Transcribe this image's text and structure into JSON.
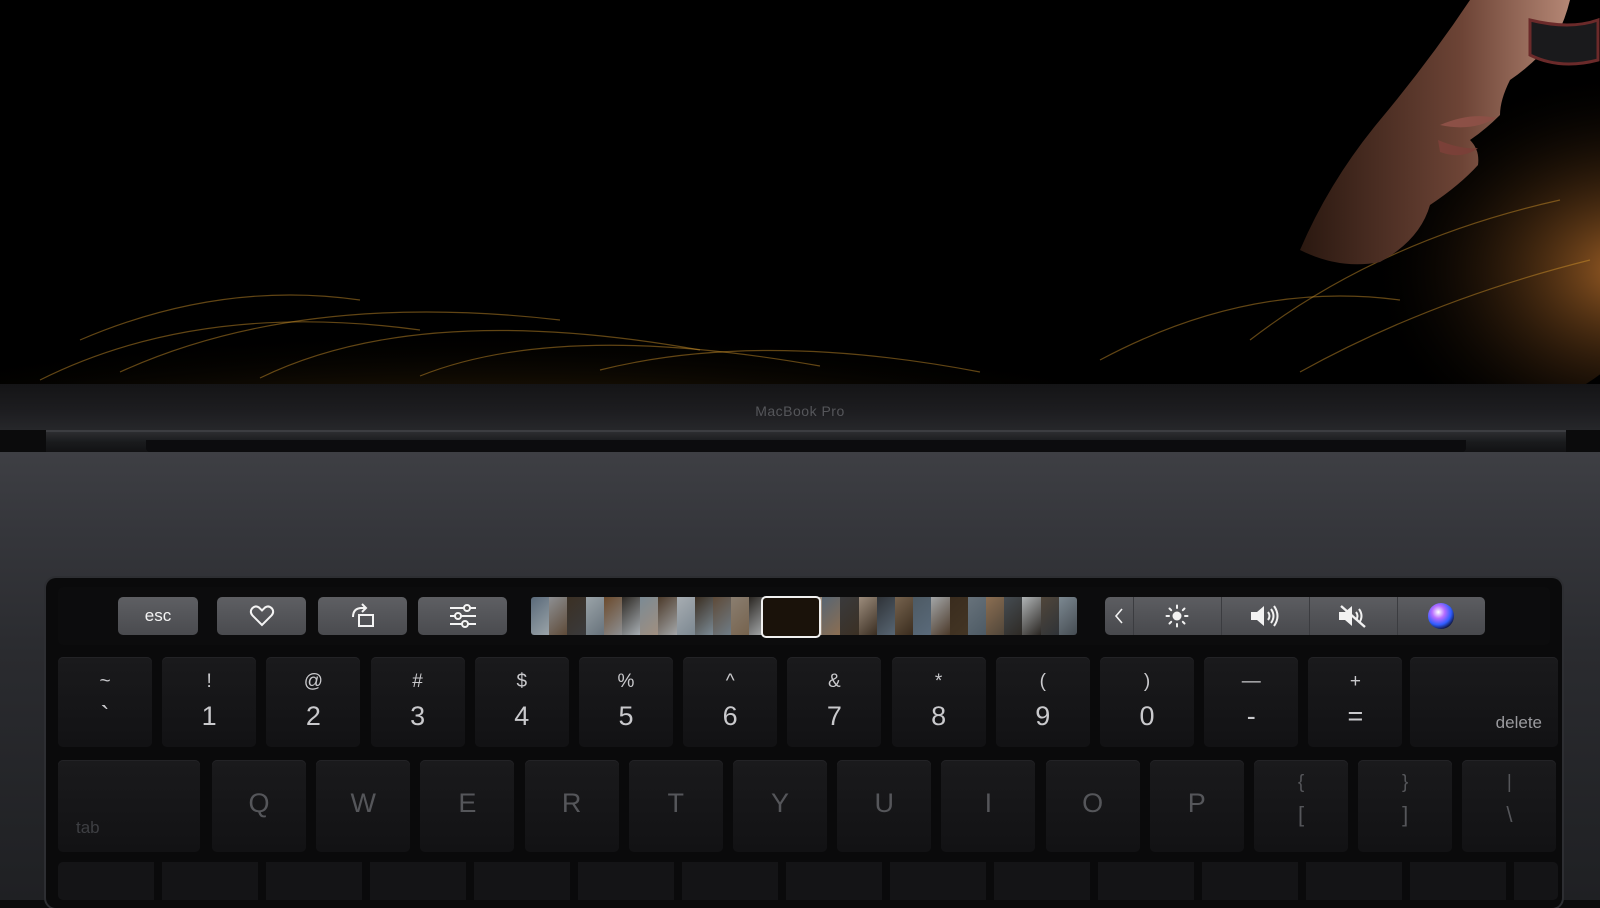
{
  "screen": {
    "brand_label": "MacBook Pro"
  },
  "touch_bar": {
    "esc_label": "esc",
    "buttons": [
      {
        "name": "favorite",
        "icon": "heart-icon"
      },
      {
        "name": "rotate",
        "icon": "rotate-icon"
      },
      {
        "name": "adjust",
        "icon": "sliders-icon"
      }
    ],
    "filmstrip": {
      "thumbnail_count": 30,
      "selected_index": 12
    },
    "control_strip": {
      "collapse_icon": "chevron-left-icon",
      "items": [
        {
          "name": "brightness",
          "icon": "brightness-icon"
        },
        {
          "name": "volume",
          "icon": "volume-icon"
        },
        {
          "name": "mute",
          "icon": "mute-icon"
        },
        {
          "name": "siri",
          "icon": "siri-icon"
        }
      ]
    },
    "colors": {
      "button_bg": "#55565a",
      "glyph": "#f4f4f4",
      "selection_border": "#f0f0f0"
    }
  },
  "keyboard": {
    "number_row": [
      {
        "top": "~",
        "bottom": "`"
      },
      {
        "top": "!",
        "bottom": "1"
      },
      {
        "top": "@",
        "bottom": "2"
      },
      {
        "top": "#",
        "bottom": "3"
      },
      {
        "top": "$",
        "bottom": "4"
      },
      {
        "top": "%",
        "bottom": "5"
      },
      {
        "top": "^",
        "bottom": "6"
      },
      {
        "top": "&",
        "bottom": "7"
      },
      {
        "top": "*",
        "bottom": "8"
      },
      {
        "top": "(",
        "bottom": "9"
      },
      {
        "top": ")",
        "bottom": "0"
      },
      {
        "top": "—",
        "bottom": "-"
      },
      {
        "top": "+",
        "bottom": "="
      }
    ],
    "delete_label": "delete",
    "tab_label": "tab",
    "letter_row": [
      "Q",
      "W",
      "E",
      "R",
      "T",
      "Y",
      "U",
      "I",
      "O",
      "P"
    ],
    "brace_keys": [
      {
        "top": "{",
        "bottom": "["
      },
      {
        "top": "}",
        "bottom": "]"
      },
      {
        "top": "|",
        "bottom": "\\"
      }
    ]
  }
}
